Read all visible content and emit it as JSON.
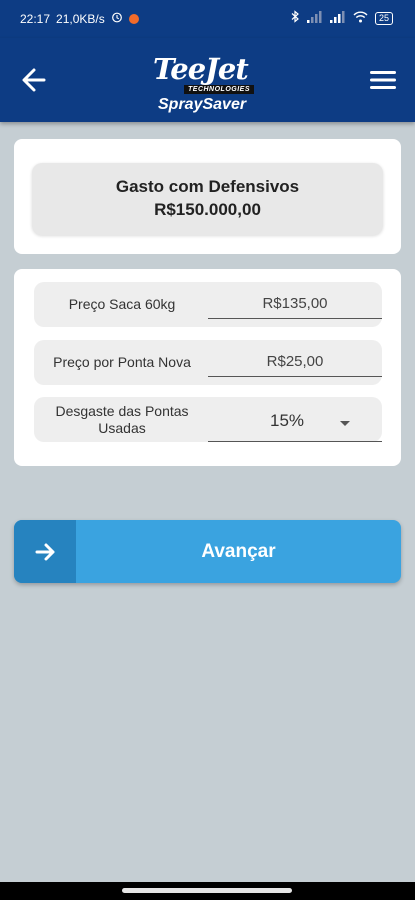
{
  "status_bar": {
    "time": "22:17",
    "network_speed": "21,0KB/s",
    "battery": "25",
    "icons": [
      "alarm-icon",
      "notification-dot-icon",
      "bluetooth-icon",
      "signal-icon",
      "signal-icon",
      "wifi-icon",
      "battery-icon"
    ],
    "dot_color": "#f26b2a"
  },
  "header": {
    "logo_main": "TeeJet",
    "logo_tech": "TECHNOLOGIES",
    "logo_sub": "SpraySaver",
    "back_icon": "arrow-left-icon",
    "menu_icon": "hamburger-menu-icon",
    "color": "#0d3c84"
  },
  "summary": {
    "title": "Gasto com Defensivos",
    "value": "R$150.000,00"
  },
  "form": {
    "rows": [
      {
        "label": "Preço Saca 60kg",
        "value": "R$135,00"
      },
      {
        "label": "Preço por Ponta Nova",
        "value": "R$25,00"
      },
      {
        "label": "Desgaste das Pontas Usadas",
        "value": "15%"
      }
    ]
  },
  "next_button": {
    "label": "Avançar",
    "icon": "arrow-right-icon",
    "color": "#3aa3e0"
  }
}
